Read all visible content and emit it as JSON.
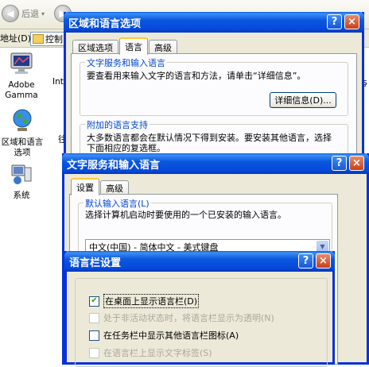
{
  "explorer": {
    "back_label": "后退",
    "address_label": "地址(D)",
    "address_value": "控制",
    "desktop_icons": [
      {
        "label": "Adobe Gamma",
        "icon": "monitor-icon"
      },
      {
        "label": "Inte",
        "icon": "generic-icon"
      },
      {
        "label": "区域和语言选项",
        "icon": "globe-icon"
      },
      {
        "label": "系统",
        "icon": "computer-icon"
      }
    ],
    "right_edge_text": "ş",
    "partial_char": "往"
  },
  "region_dialog": {
    "title": "区域和语言选项",
    "help": "?",
    "close": "×",
    "tabs": [
      "区域选项",
      "语言",
      "高级"
    ],
    "active_tab": "语言",
    "text_services": {
      "title": "文字服务和输入语言",
      "description": "要查看用来输入文字的语言和方法，请单击“详细信息”。",
      "details_button": "详细信息(D)..."
    },
    "supplemental": {
      "title": "附加的语言支持",
      "description_line1": "大多数语言都会在默认情况下得到安装。要安装其他语言，选择",
      "description_line2": "下面相应的复选框。"
    }
  },
  "text_services_dialog": {
    "title": "文字服务和输入语言",
    "help": "?",
    "close": "×",
    "tabs": [
      "设置",
      "高级"
    ],
    "active_tab": "设置",
    "default_input": {
      "title": "默认输入语言(L)",
      "description": "选择计算机启动时要使用的一个已安装的输入语言。",
      "selected": "中文(中国) - 简体中文 - 美式键盘"
    }
  },
  "langbar_dialog": {
    "title": "语言栏设置",
    "help": "?",
    "close": "×",
    "options": [
      {
        "label": "在桌面上显示语言栏(D)",
        "checked": true,
        "enabled": true
      },
      {
        "label": "处于非活动状态时，将语言栏显示为透明(N)",
        "checked": false,
        "enabled": false
      },
      {
        "label": "在任务栏中显示其他语言栏图标(A)",
        "checked": false,
        "enabled": true
      },
      {
        "label": "在语言栏上显示文字标签(S)",
        "checked": false,
        "enabled": false
      }
    ]
  },
  "colors": {
    "xp_blue": "#0a58e0",
    "window_face": "#ece9d8",
    "group_title": "#0046d5"
  }
}
